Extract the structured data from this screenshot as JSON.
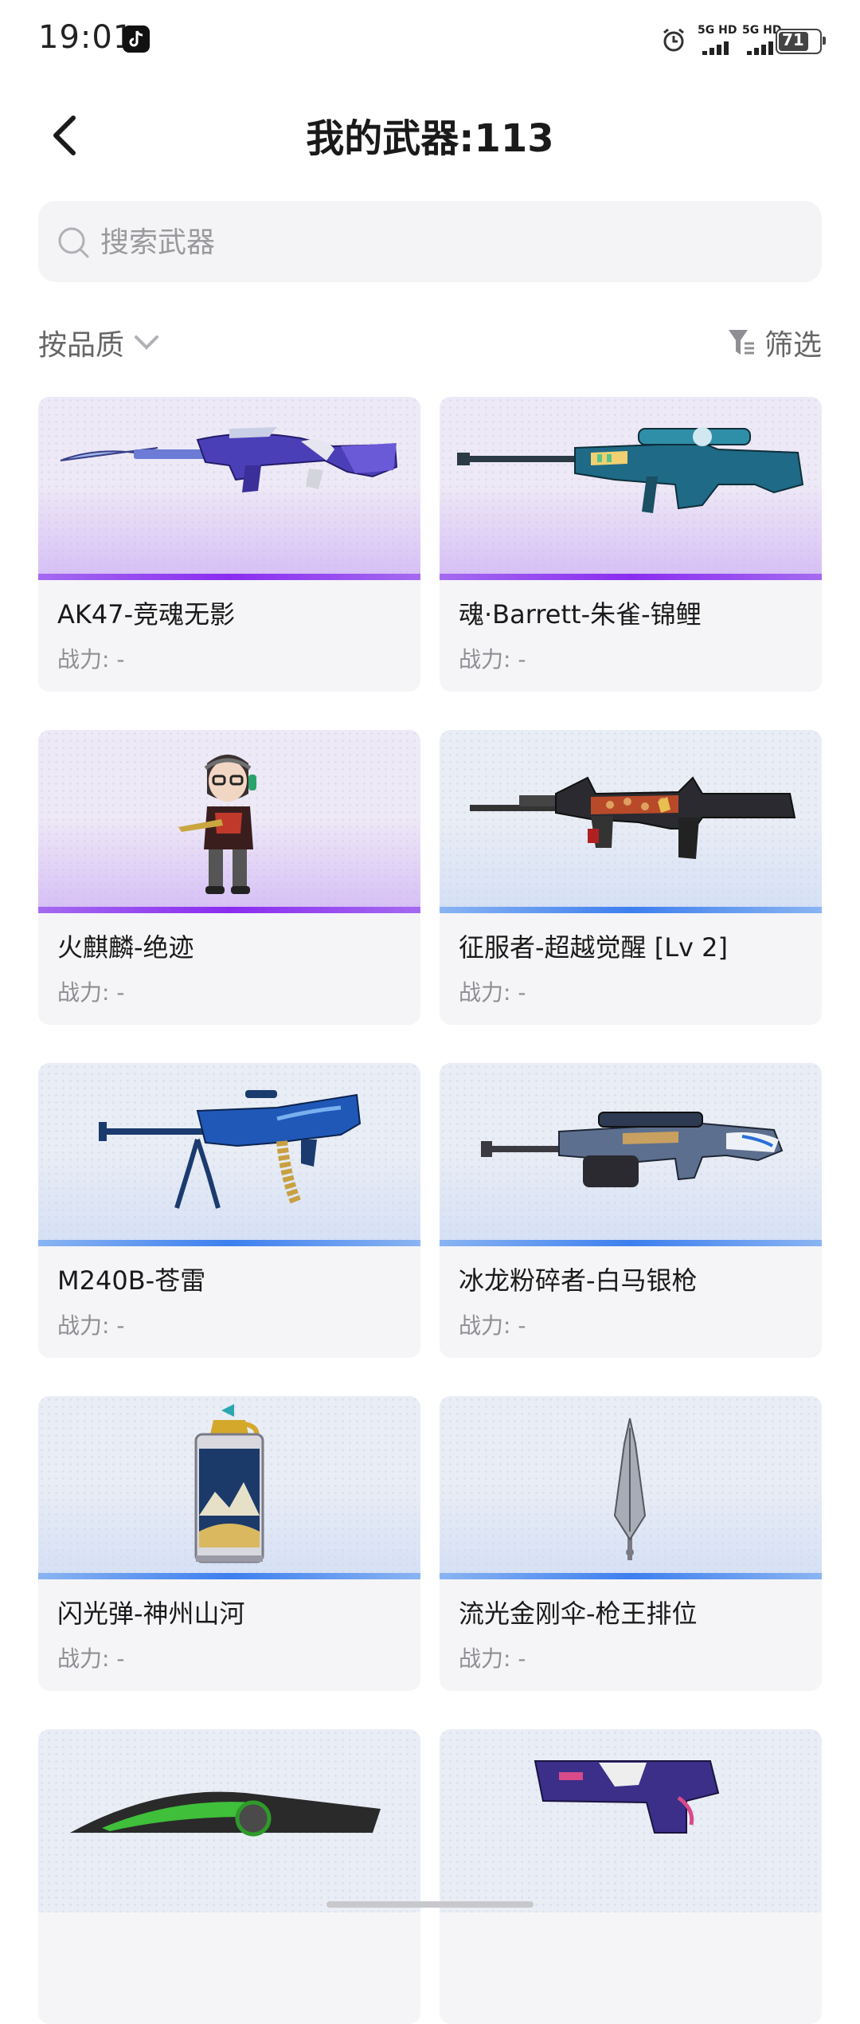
{
  "status_bar": {
    "time": "19:01",
    "network_1": "5G HD",
    "network_2": "5G HD",
    "battery": "71"
  },
  "header": {
    "title": "我的武器:113",
    "back_icon": "chevron-left-icon"
  },
  "search": {
    "placeholder": "搜索武器",
    "value": "",
    "icon": "search-icon"
  },
  "toolbar": {
    "sort_label": "按品质",
    "filter_label": "筛选"
  },
  "weapons": [
    {
      "name": "AK47-竞魂无影",
      "power": "战力: -",
      "tier": "purple"
    },
    {
      "name": "魂·Barrett-朱雀-锦鲤",
      "power": "战力: -",
      "tier": "purple"
    },
    {
      "name": "火麒麟-绝迹",
      "power": "战力: -",
      "tier": "purple"
    },
    {
      "name": "征服者-超越觉醒 [Lv 2]",
      "power": "战力: -",
      "tier": "blue"
    },
    {
      "name": "M240B-苍雷",
      "power": "战力: -",
      "tier": "blue"
    },
    {
      "name": "冰龙粉碎者-白马银枪",
      "power": "战力: -",
      "tier": "blue"
    },
    {
      "name": "闪光弹-神州山河",
      "power": "战力: -",
      "tier": "blue"
    },
    {
      "name": "流光金刚伞-枪王排位",
      "power": "战力: -",
      "tier": "blue"
    },
    {
      "name": "",
      "power": "",
      "tier": "blue"
    },
    {
      "name": "",
      "power": "",
      "tier": "blue"
    }
  ],
  "colors": {
    "purple_tier": "#8a2cf0",
    "blue_tier": "#3d7fef",
    "card_bg": "#f5f5f7"
  }
}
